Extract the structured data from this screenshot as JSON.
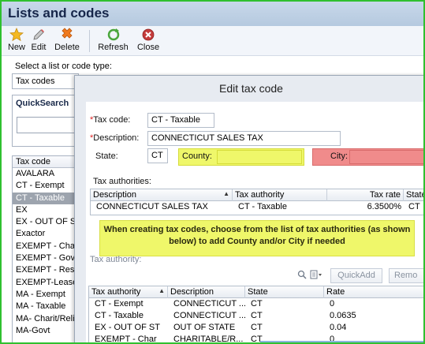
{
  "window": {
    "title": "Lists and codes"
  },
  "toolbar": {
    "new_label": "New",
    "edit_label": "Edit",
    "delete_label": "Delete",
    "refresh_label": "Refresh",
    "close_label": "Close"
  },
  "left_panel": {
    "type_label": "Select a list or code type:",
    "type_value": "Tax codes",
    "quicksearch_title": "QuickSearch",
    "list_header": "Tax code",
    "items": [
      "AVALARA",
      "CT - Exempt",
      "CT - Taxable",
      "EX",
      "EX - OUT OF ST",
      "Exactor",
      "EXEMPT - Char",
      "EXEMPT - Govt",
      "EXEMPT - Resal",
      "EXEMPT-Lease",
      "MA - Exempt",
      "MA - Taxable",
      "MA- Charit/Reli",
      "MA-Govt"
    ],
    "selected_index": 2
  },
  "dialog": {
    "title": "Edit tax code",
    "tax_code_label": "Tax code:",
    "tax_code_value": "CT - Taxable",
    "description_label": "Description:",
    "description_value": "CONNECTICUT SALES TAX",
    "state_label": "State:",
    "state_value": "CT",
    "county_label": "County:",
    "city_label": "City:",
    "tax_authorities_label": "Tax authorities:",
    "authorities_columns": [
      "Description",
      "Tax authority",
      "Tax rate",
      "State"
    ],
    "authorities_rows": [
      {
        "description": "CONNECTICUT SALES TAX",
        "authority": "CT - Taxable",
        "rate": "6.3500%",
        "state": "CT"
      }
    ],
    "callout": "When creating tax codes, choose from the list of tax authorities (as shown below)  to add County and/or City if needed",
    "tax_authority_label": "Tax authority:",
    "quickadd_label": "QuickAdd",
    "remove_label": "Remo",
    "lookup_columns": [
      "Tax authority",
      "Description",
      "State",
      "Rate"
    ],
    "lookup_rows": [
      {
        "authority": "CT - Exempt",
        "description": "CONNECTICUT ...",
        "state": "CT",
        "rate": "0"
      },
      {
        "authority": "CT - Taxable",
        "description": "CONNECTICUT ...",
        "state": "CT",
        "rate": "0.0635"
      },
      {
        "authority": "EX - OUT OF ST",
        "description": "OUT OF STATE",
        "state": "CT",
        "rate": "0.04"
      },
      {
        "authority": "EXEMPT - Char",
        "description": "CHARITABLE/R...",
        "state": "CT",
        "rate": "0"
      }
    ]
  },
  "colors": {
    "frame_green": "#2fc02f",
    "callout_yellow": "#eff76a",
    "city_red": "#f08b8b",
    "selection": "#9da4ae"
  }
}
